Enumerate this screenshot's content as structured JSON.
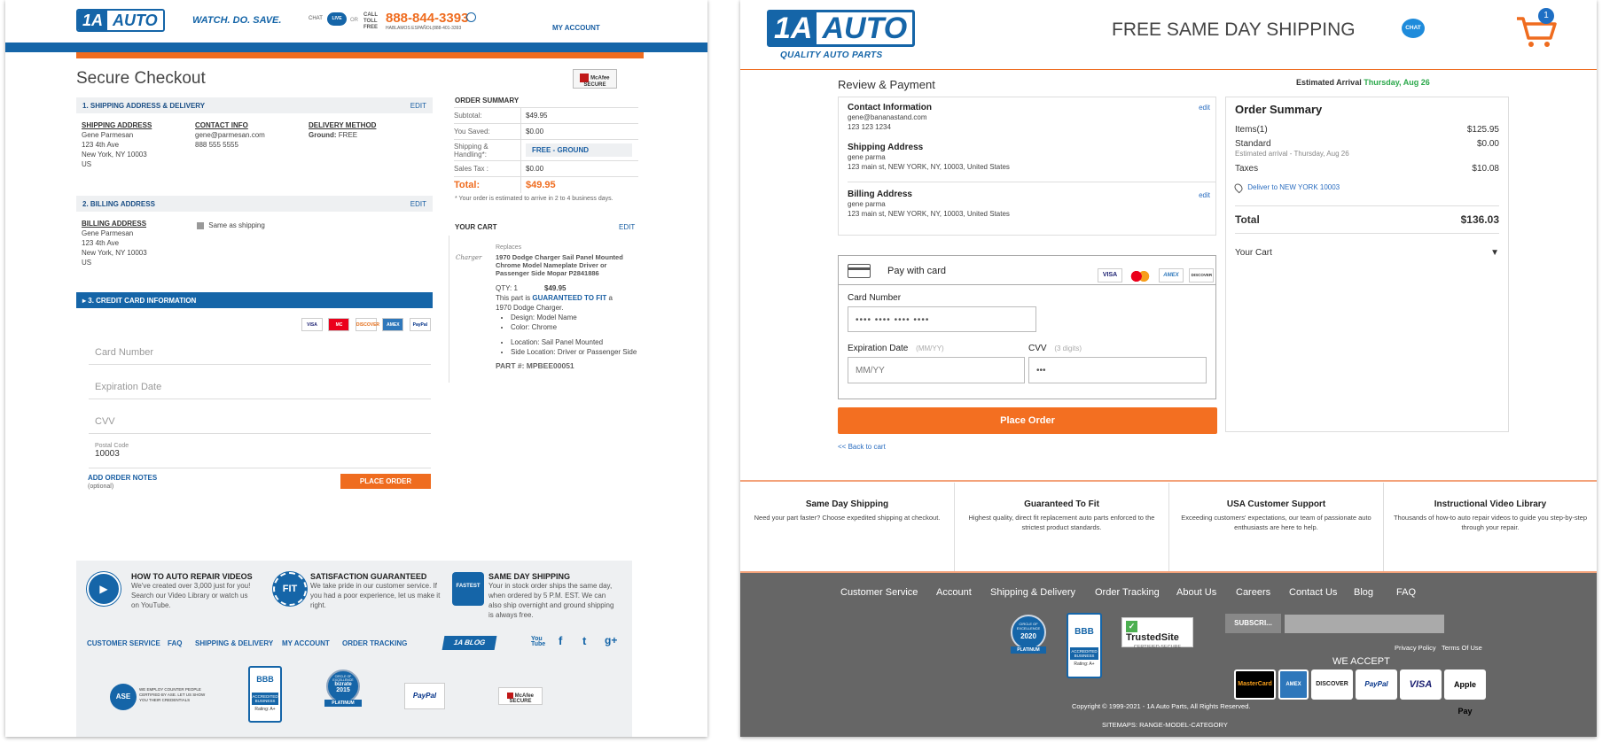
{
  "left": {
    "header": {
      "logo_one": "1A",
      "logo_auto": "AUTO",
      "tagline": "WATCH. DO. SAVE.",
      "chat_label": "CHAT",
      "chat_live": "LIVE",
      "or_label": "OR",
      "call_toll_free": "CALL TOLL FREE",
      "phone": "888-844-3393",
      "hablamos": "HABLAMOS ESPAÑOL(888-401-3393",
      "my_account": "MY ACCOUNT"
    },
    "checkout_title": "Secure Checkout",
    "mcafee": "McAfee SECURE",
    "shipping_section": {
      "title": "1. SHIPPING ADDRESS & DELIVERY",
      "edit": "EDIT",
      "address_label": "SHIPPING ADDRESS",
      "address_lines": [
        "Gene Parmesan",
        "123 4th Ave",
        "New York, NY 10003",
        "US"
      ],
      "contact_label": "CONTACT INFO",
      "contact_lines": [
        "gene@parmesan.com",
        "888 555 5555"
      ],
      "delivery_label": "DELIVERY METHOD",
      "delivery_key": "Ground:",
      "delivery_value": "FREE"
    },
    "billing_section": {
      "title": "2. BILLING ADDRESS",
      "edit": "EDIT",
      "address_label": "BILLING ADDRESS",
      "address_lines": [
        "Gene Parmesan",
        "123 4th Ave",
        "New York, NY 10003",
        "US"
      ],
      "same_as_shipping": "Same as shipping"
    },
    "credit_section": {
      "title": "3. CREDIT CARD INFORMATION",
      "cards": [
        "VISA",
        "MC",
        "DISCOVER",
        "AMEX",
        "PayPal"
      ],
      "card_number_placeholder": "Card Number",
      "expiration_placeholder": "Expiration Date",
      "cvv_placeholder": "CVV",
      "postal_label": "Postal Code",
      "postal_value": "10003",
      "add_notes": "ADD ORDER NOTES",
      "optional": "(optional)",
      "place_order": "PLACE ORDER"
    },
    "order_summary": {
      "title": "ORDER SUMMARY",
      "subtotal_label": "Subtotal:",
      "subtotal": "$49.95",
      "saved_label": "You Saved:",
      "saved": "$0.00",
      "shipping_label": "Shipping & Handling*:",
      "shipping": "FREE - GROUND",
      "tax_label": "Sales Tax :",
      "tax": "$0.00",
      "total_label": "Total:",
      "total": "$49.95",
      "note": "* Your order is estimated to arrive in 2 to 4 business days."
    },
    "cart": {
      "title": "YOUR CART",
      "edit": "EDIT",
      "replaces": "Replaces",
      "product_name": "1970 Dodge Charger Sail Panel Mounted Chrome Model Nameplate Driver or Passenger Side Mopar P2841886",
      "qty": "QTY: 1",
      "price": "$49.95",
      "fit_pre": "This part is",
      "fit_link": "GUARANTEED TO FIT",
      "fit_post": "a 1970 Dodge Charger.",
      "bullets1": [
        "Design: Model Name",
        "Color: Chrome"
      ],
      "bullets2": [
        "Location: Sail Panel Mounted",
        "Side Location: Driver or Passenger Side"
      ],
      "part_no": "PART #: MPBEE00051",
      "thumb_text": "Charger"
    },
    "features": [
      {
        "title": "HOW TO AUTO REPAIR VIDEOS",
        "desc": "We've created over 3,000 just for you! Search our Video Library or watch us on YouTube.",
        "icon": "video-seal-icon"
      },
      {
        "title": "SATISFACTION GUARANTEED",
        "desc": "We take pride in our customer service. If you had a poor experience, let us make it right.",
        "icon": "fit-seal-icon"
      },
      {
        "title": "SAME DAY SHIPPING",
        "desc": "Your in stock order ships the same day, when ordered by 5 P.M. EST. We can also ship overnight and ground shipping is always free.",
        "icon": "fastest-shipping-icon"
      }
    ],
    "footer_links": [
      "CUSTOMER SERVICE",
      "FAQ",
      "SHIPPING & DELIVERY",
      "MY ACCOUNT",
      "ORDER TRACKING"
    ],
    "blog_label": "1A BLOG",
    "social": [
      "You Tube",
      "f",
      "t",
      "g+"
    ],
    "seals": {
      "ase_big": "ASE",
      "ase": "WE EMPLOY COUNTER PEOPLE CERTIFIED BY ASE. LET US SHOW YOU THEIR CREDENTIALS",
      "bbb_mark": "BBB",
      "bbb": "ACCREDITED BUSINESS",
      "bbb_rating": "Rating: A+",
      "bizrate_top": "CIRCLE OF EXCELLENCE",
      "bizrate_mid": "bizrate",
      "bizrate_year": "2015",
      "bizrate_tier": "PLATINUM",
      "paypal": "PayPal",
      "mcafee": "McAfee SECURE"
    }
  },
  "right": {
    "logo_one": "1A",
    "logo_auto": "AUTO",
    "logo_sub": "QUALITY AUTO PARTS",
    "banner": "FREE SAME DAY SHIPPING",
    "chat": "CHAT",
    "cart_count": "1",
    "review_title": "Review & Payment",
    "estimated_label": "Estimated Arrival",
    "estimated_date": "Thursday, Aug 26",
    "contact": {
      "label": "Contact Information",
      "edit": "edit",
      "email": "gene@bananastand.com",
      "phone": "123 123 1234"
    },
    "shipping": {
      "label": "Shipping Address",
      "name": "gene parma",
      "address": "123 main st, NEW YORK, NY, 10003, United States"
    },
    "billing": {
      "label": "Billing Address",
      "edit": "edit",
      "name": "gene parma",
      "address": "123 main st, NEW YORK, NY, 10003, United States"
    },
    "payment": {
      "pay_with_card": "Pay with card",
      "cards": [
        "VISA",
        "MC",
        "AMEX",
        "DISCOVER"
      ],
      "card_number_label": "Card Number",
      "card_number_value": "•••• •••• •••• ••••",
      "exp_label": "Expiration Date",
      "exp_hint": "(MM/YY)",
      "exp_placeholder": "MM/YY",
      "cvv_label": "CVV",
      "cvv_hint": "(3 digits)",
      "cvv_value": "•••"
    },
    "place_order": "Place Order",
    "back_to_cart": "<< Back to cart",
    "summary": {
      "title": "Order Summary",
      "items_label": "Items(1)",
      "items": "$125.95",
      "standard_label": "Standard",
      "standard": "$0.00",
      "est_arrival": "Estimated arrival - Thursday, Aug 26",
      "taxes_label": "Taxes",
      "taxes": "$10.08",
      "deliver_to": "Deliver to NEW YORK 10003",
      "total_label": "Total",
      "total": "$136.03",
      "your_cart": "Your Cart",
      "toggle": "▼"
    },
    "features": [
      {
        "title": "Same Day Shipping",
        "desc": "Need your part faster? Choose expedited shipping at checkout."
      },
      {
        "title": "Guaranteed To Fit",
        "desc": "Highest quality, direct fit replacement auto parts enforced to the strictest product standards."
      },
      {
        "title": "USA Customer Support",
        "desc": "Exceeding customers' expectations, our team of passionate auto enthusiasts are here to help."
      },
      {
        "title": "Instructional Video Library",
        "desc": "Thousands of how-to auto repair videos to guide you step-by-step through your repair."
      }
    ],
    "footer_nav": [
      "Customer Service",
      "Account",
      "Shipping & Delivery",
      "Order Tracking",
      "About Us",
      "Careers",
      "Contact Us",
      "Blog",
      "FAQ"
    ],
    "badges": {
      "circle_top": "CIRCLE OF EXCELLENCE",
      "circle_year": "2020",
      "circle_tier": "PLATINUM",
      "bbb_mark": "BBB",
      "bbb": "ACCREDITED BUSINESS",
      "bbb_rating": "Rating: A+",
      "trusted_name": "TrustedSite",
      "trusted_sub": "CERTIFIED SECURE"
    },
    "subscribe_label": "SUBSCRI...",
    "privacy": "Privacy Policy",
    "terms": "Terms Of Use",
    "we_accept": "WE ACCEPT",
    "accept_cards": [
      "MasterCard",
      "AMEX",
      "DISCOVER",
      "PayPal",
      "VISA",
      "Apple Pay"
    ],
    "copyright": "Copyright © 1999-2021 - 1A Auto Parts, All Rights Reserved.",
    "sitemaps": "SITEMAPS: RANGE-MODEL-CATEGORY"
  }
}
